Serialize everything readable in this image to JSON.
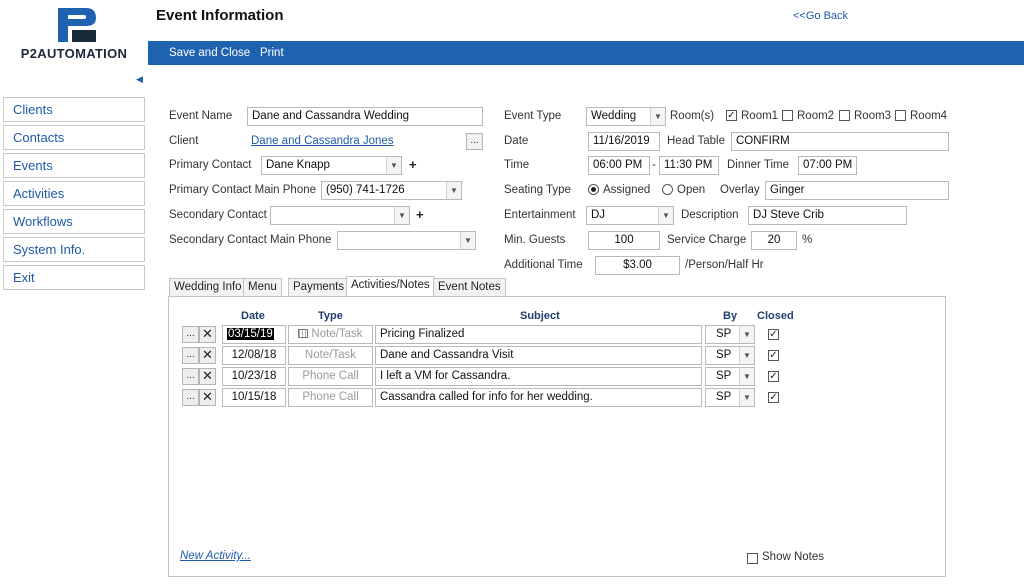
{
  "logo": {
    "text": "P2AUTOMATION"
  },
  "header": {
    "title": "Event Information",
    "back_link": "<<Go Back"
  },
  "toolbar": {
    "save_close": "Save and Close",
    "print": "Print"
  },
  "sidebar": {
    "items": [
      "Clients",
      "Contacts",
      "Events",
      "Activities",
      "Workflows",
      "System Info.",
      "Exit"
    ]
  },
  "form": {
    "event_name_label": "Event Name",
    "event_name": "Dane and Cassandra Wedding",
    "client_label": "Client",
    "client": "Dane and Cassandra Jones",
    "client_btn": "...",
    "primary_contact_label": "Primary Contact",
    "primary_contact": "Dane Knapp",
    "primary_phone_label": "Primary Contact Main Phone",
    "primary_phone": "(950) 741-1726",
    "secondary_contact_label": "Secondary Contact",
    "secondary_contact": "",
    "secondary_phone_label": "Secondary Contact Main Phone",
    "secondary_phone": "",
    "plus": "+",
    "event_type_label": "Event Type",
    "event_type": "Wedding",
    "rooms_label": "Room(s)",
    "rooms": [
      {
        "label": "Room1",
        "checked": true
      },
      {
        "label": "Room2",
        "checked": false
      },
      {
        "label": "Room3",
        "checked": false
      },
      {
        "label": "Room4",
        "checked": false
      }
    ],
    "date_label": "Date",
    "date": "11/16/2019",
    "head_table_label": "Head Table",
    "head_table": "CONFIRM",
    "time_label": "Time",
    "time_start": "06:00 PM",
    "time_sep": "-",
    "time_end": "11:30 PM",
    "dinner_time_label": "Dinner Time",
    "dinner_time": "07:00 PM",
    "seating_type_label": "Seating Type",
    "seating_assigned": "Assigned",
    "seating_open": "Open",
    "overlay_label": "Overlay",
    "overlay": "Ginger",
    "entertainment_label": "Entertainment",
    "entertainment": "DJ",
    "description_label": "Description",
    "description": "DJ Steve Crib",
    "min_guests_label": "Min. Guests",
    "min_guests": "100",
    "service_charge_label": "Service Charge",
    "service_charge": "20",
    "service_charge_unit": "%",
    "additional_time_label": "Additional Time",
    "additional_time": "$3.00",
    "additional_time_unit": "/Person/Half Hr"
  },
  "tabs": [
    "Wedding Info",
    "Menu",
    "Payments",
    "Activities/Notes",
    "Event Notes"
  ],
  "activities": {
    "columns": {
      "date": "Date",
      "type": "Type",
      "subject": "Subject",
      "by": "By",
      "closed": "Closed"
    },
    "rows": [
      {
        "date": "03/15/19",
        "type": "Note/Task",
        "subject": "Pricing Finalized",
        "by": "SP",
        "closed": true
      },
      {
        "date": "12/08/18",
        "type": "Note/Task",
        "subject": "Dane and Cassandra Visit",
        "by": "SP",
        "closed": true
      },
      {
        "date": "10/23/18",
        "type": "Phone Call",
        "subject": "I left a VM for Cassandra.",
        "by": "SP",
        "closed": true
      },
      {
        "date": "10/15/18",
        "type": "Phone Call",
        "subject": "Cassandra called for info for her wedding.",
        "by": "SP",
        "closed": true
      }
    ],
    "new_activity": "New Activity...",
    "show_notes": "Show Notes"
  },
  "icons": {
    "row_menu": "...",
    "row_delete": "✕",
    "dropdown": "▼",
    "check": "✓"
  }
}
